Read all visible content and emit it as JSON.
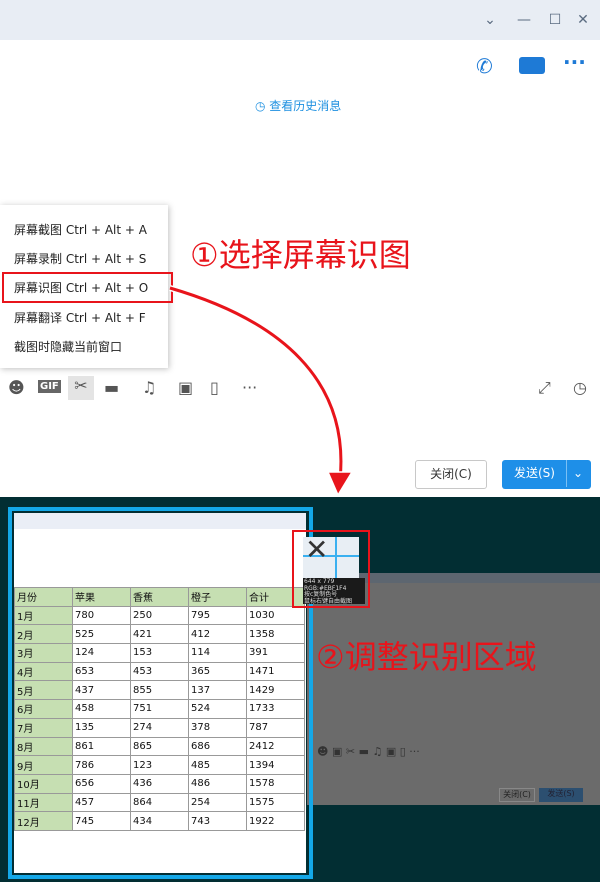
{
  "window": {
    "controls": [
      "chevron-down",
      "minimize",
      "maximize",
      "close"
    ]
  },
  "chat": {
    "history_link": "查看历史消息"
  },
  "menu": {
    "items": [
      "屏幕截图 Ctrl + Alt + A",
      "屏幕录制 Ctrl + Alt + S",
      "屏幕识图 Ctrl + Alt + O",
      "屏幕翻译 Ctrl + Alt + F",
      "截图时隐藏当前窗口"
    ],
    "selected_index": 2
  },
  "annotations": {
    "step1": "①选择屏幕识图",
    "step2": "②调整识别区域"
  },
  "toolbar": {
    "gif": "GIF",
    "more": "···"
  },
  "buttons": {
    "close": "关闭(C)",
    "send": "发送(S)"
  },
  "magnifier": {
    "size": "644 x 779",
    "rgb": "RGB:#EBF1F4",
    "hint1": "按c复制色号",
    "hint2": "鼠标右键自由截图"
  },
  "table": {
    "headers": [
      "月份",
      "苹果",
      "香蕉",
      "橙子",
      "合计"
    ],
    "rows": [
      [
        "1月",
        "780",
        "250",
        "795",
        "1030"
      ],
      [
        "2月",
        "525",
        "421",
        "412",
        "1358"
      ],
      [
        "3月",
        "124",
        "153",
        "114",
        "391"
      ],
      [
        "4月",
        "653",
        "453",
        "365",
        "1471"
      ],
      [
        "5月",
        "437",
        "855",
        "137",
        "1429"
      ],
      [
        "6月",
        "458",
        "751",
        "524",
        "1733"
      ],
      [
        "7月",
        "135",
        "274",
        "378",
        "787"
      ],
      [
        "8月",
        "861",
        "865",
        "686",
        "2412"
      ],
      [
        "9月",
        "786",
        "123",
        "485",
        "1394"
      ],
      [
        "10月",
        "656",
        "436",
        "486",
        "1578"
      ],
      [
        "11月",
        "457",
        "864",
        "254",
        "1575"
      ],
      [
        "12月",
        "745",
        "434",
        "743",
        "1922"
      ]
    ]
  },
  "mini": {
    "close": "关闭(C)",
    "send": "发送(S)"
  },
  "colors": {
    "accent": "#1e7ad6",
    "annotation": "#e8141b",
    "overlay": "#022e33",
    "selection": "#14a8e8"
  }
}
